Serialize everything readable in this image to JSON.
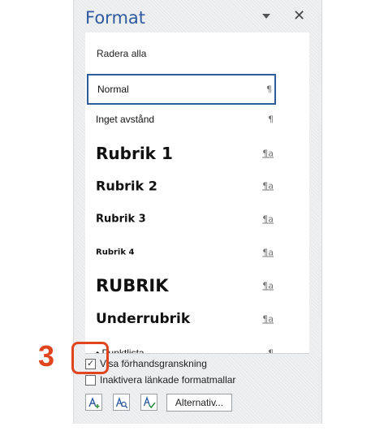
{
  "pane": {
    "title": "Format",
    "clear_all": "Radera alla"
  },
  "styles": [
    {
      "label": "Normal",
      "mark": "¶"
    },
    {
      "label": "Inget avstånd",
      "mark": "¶"
    },
    {
      "label": "Rubrik 1",
      "mark": "¶a"
    },
    {
      "label": "Rubrik 2",
      "mark": "¶a"
    },
    {
      "label": "Rubrik 3",
      "mark": "¶a"
    },
    {
      "label": "Rubrik 4",
      "mark": "¶a"
    },
    {
      "label": "RUBRIK",
      "mark": "¶a"
    },
    {
      "label": "Underrubrik",
      "mark": "¶a"
    },
    {
      "label": "Punktlista",
      "mark": "¶"
    }
  ],
  "selected_style": "Normal",
  "options": {
    "show_preview": {
      "label": "Visa förhandsgranskning",
      "checked": true
    },
    "disable_linked": {
      "label": "Inaktivera länkade formatmallar",
      "checked": false
    }
  },
  "buttons": {
    "new_style_icon": "new-style-icon",
    "style_inspector_icon": "style-inspector-icon",
    "manage_styles_icon": "manage-styles-icon",
    "options_label": "Alternativ..."
  },
  "annotation": {
    "step_number": "3",
    "color": "#e0451e"
  }
}
